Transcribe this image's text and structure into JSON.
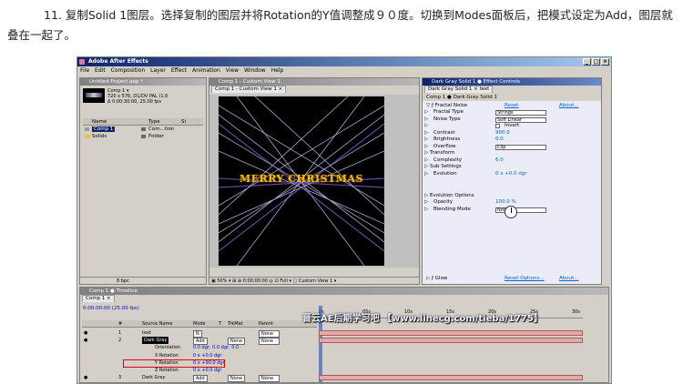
{
  "caption": "11. 复制Solid 1图层。选择复制的图层并将Rotation的Y值调整成９０度。切换到Modes面板后，把模式设定为Add，图层就叠在一起了。",
  "app": {
    "title": "Adobe After Effects",
    "menu": [
      "File",
      "Edit",
      "Composition",
      "Layer",
      "Effect",
      "Animation",
      "View",
      "Window",
      "Help"
    ]
  },
  "project": {
    "title": "Untitled Project.aep *",
    "comp_name": "Comp 1 ▾",
    "info_lines": [
      "720 x 576, D1/DV PAL (1.0",
      "Δ 0:00:30:00, 25.00 fps"
    ],
    "cols": [
      "Name",
      "Type",
      "Si"
    ],
    "items": [
      {
        "name": "Comp 1",
        "type": "Com...tion"
      },
      {
        "name": "Solids",
        "type": "Folder"
      }
    ],
    "footer": "8 bpc"
  },
  "comp_view": {
    "title": "Comp 1 - Custom View 1",
    "tab": "Comp 1 - Custom View 1 ×",
    "text": "MERRY CHRISTMAS",
    "zoom": "50%",
    "bottom": "▣ 50% ▾  ⊞  ⊕  0:00:00:00  ◎ ⊡ Full ▾ ▢ Custom View 1 ▾"
  },
  "effects": {
    "title": "Dark Gray Solid 1 ● Effect Controls",
    "tab": "Dark Gray Solid 1 × text",
    "layer": "Comp 1 ● Dark Gray Solid 1",
    "fx_name": "Fractal Noise",
    "reset": "Reset",
    "about": "About...",
    "rows": [
      {
        "name": "Fractal Type",
        "val": "Strings",
        "kind": "dd"
      },
      {
        "name": "Noise Type",
        "val": "Soft Linear",
        "kind": "dd"
      },
      {
        "name": "",
        "val": "Invert",
        "kind": "chk"
      },
      {
        "name": "Contrast",
        "val": "900.0",
        "kind": "num"
      },
      {
        "name": "Brightness",
        "val": "0.0",
        "kind": "num"
      },
      {
        "name": "Overflow",
        "val": "Clip",
        "kind": "dd"
      },
      {
        "name": "Transform",
        "val": "",
        "kind": "grp"
      },
      {
        "name": "Complexity",
        "val": "6.0",
        "kind": "num"
      },
      {
        "name": "Sub Settings",
        "val": "",
        "kind": "grp"
      },
      {
        "name": "Evolution",
        "val": "0 x +0.0 dgr",
        "kind": "num"
      },
      {
        "name": "Evolution Options",
        "val": "",
        "kind": "grp"
      },
      {
        "name": "Opacity",
        "val": "100.0 %",
        "kind": "num"
      },
      {
        "name": "Blending Mode",
        "val": "Normal",
        "kind": "dd"
      }
    ],
    "glow": "Glow",
    "glow_reset": "Reset Options...",
    "glow_about": "About..."
  },
  "timeline": {
    "title": "Comp 1 ● Timeline",
    "tab": "Comp 1 ×",
    "timecode": "0:00:00:00 (25.00 fps)",
    "ruler": [
      "0s",
      "05s",
      "10s",
      "15s",
      "20s",
      "25s",
      "30s"
    ],
    "head": [
      "#",
      "Source Name",
      "Mode",
      "T",
      "TrkMat",
      "Parent"
    ],
    "rows": [
      {
        "num": "1",
        "name": "text",
        "mode": "N",
        "trk": "",
        "parent": "None"
      },
      {
        "num": "2",
        "name": "Dark Gray",
        "mode": "Add",
        "trk": "None",
        "parent": "None"
      },
      {
        "num": "",
        "name": "Orientation",
        "mode": "0.0 dgr, 0.0 dgr, 0.0",
        "trk": "",
        "parent": ""
      },
      {
        "num": "",
        "name": "X Rotation",
        "mode": "0 x +0.0 dgr",
        "trk": "",
        "parent": ""
      },
      {
        "num": "",
        "name": "Y Rotation",
        "mode": "0 x +90.0 dgr",
        "trk": "",
        "parent": ""
      },
      {
        "num": "",
        "name": "Z Rotation",
        "mode": "0 x +0.0 dgr",
        "trk": "",
        "parent": ""
      },
      {
        "num": "3",
        "name": "Dark Gray",
        "mode": "Add",
        "trk": "None",
        "parent": "None"
      }
    ]
  },
  "watermark": "晋云AE后期学习吧 【www.linecg.com/tieba/1775】"
}
